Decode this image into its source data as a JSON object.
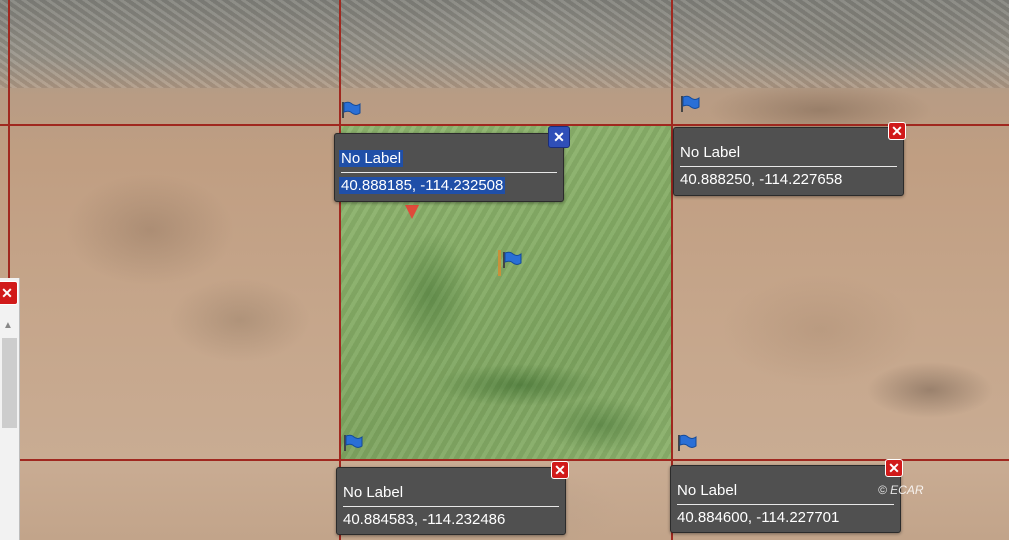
{
  "map": {
    "imagery": "satellite",
    "copyright": "© ECAR",
    "highlight_color": "#86ad66",
    "boundary_color": "#a0281f"
  },
  "popups": [
    {
      "id": "top-center",
      "label": "No Label",
      "coords": "40.888185, -114.232508",
      "selected": true,
      "close_icon": "close-icon"
    },
    {
      "id": "top-right",
      "label": "No Label",
      "coords": "40.888250, -114.227658",
      "selected": false,
      "close_icon": "close-icon"
    },
    {
      "id": "bottom-center",
      "label": "No Label",
      "coords": "40.884583, -114.232486",
      "selected": false,
      "close_icon": "close-icon"
    },
    {
      "id": "bottom-right",
      "label": "No Label",
      "coords": "40.884600, -114.227701",
      "selected": false,
      "close_icon": "close-icon"
    }
  ],
  "markers": {
    "flag_icon": "flag-icon",
    "pin_icon": "map-pin-icon"
  },
  "side_panel": {
    "close_icon": "close-icon",
    "scroll_up_icon": "scroll-up-icon"
  }
}
